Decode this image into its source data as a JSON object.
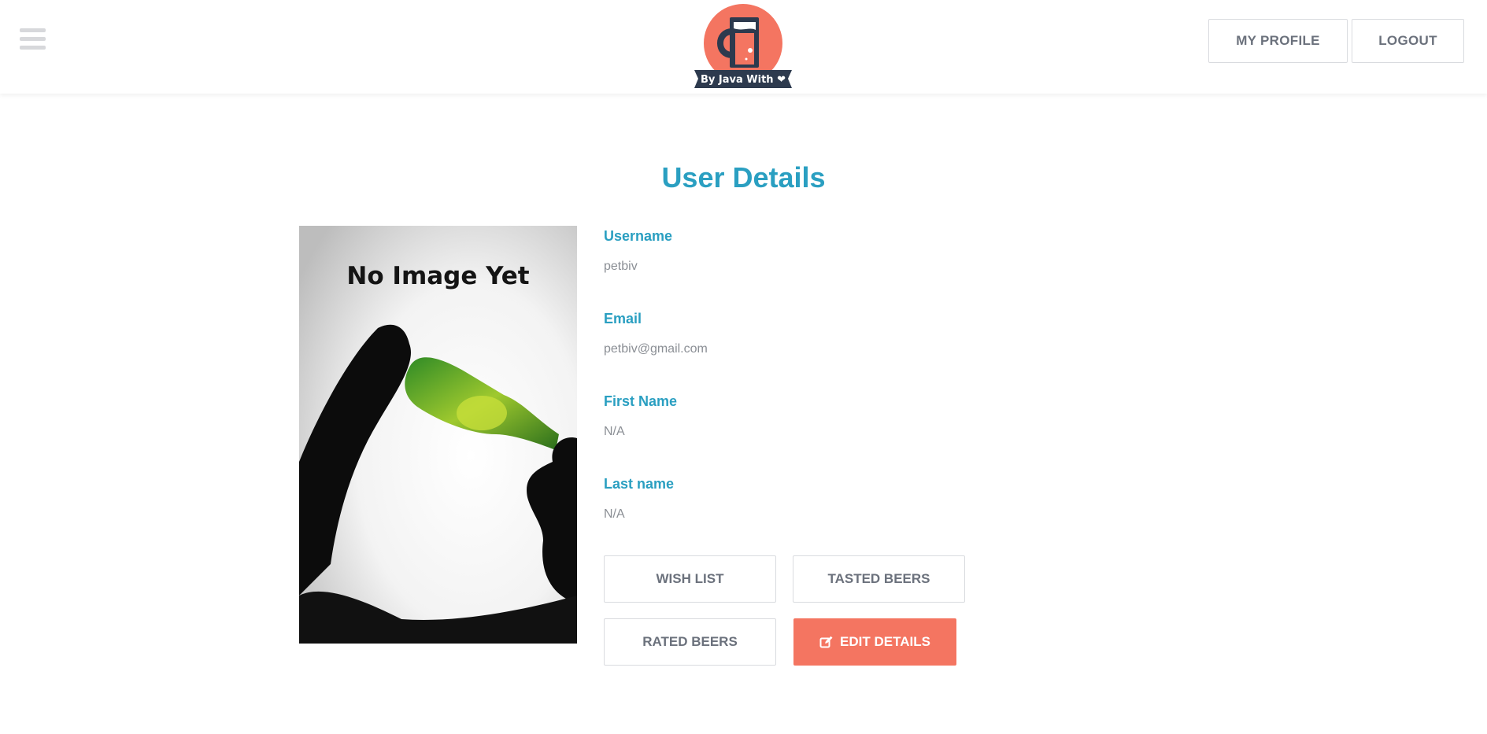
{
  "header": {
    "logo_text": "By Java With ❤",
    "nav": {
      "my_profile": "MY PROFILE",
      "logout": "LOGOUT"
    },
    "icons": [
      "hamburger-menu-icon",
      "beer-logo-icon"
    ]
  },
  "page": {
    "title": "User Details"
  },
  "profile_image": {
    "caption": "No Image Yet"
  },
  "details": {
    "username": {
      "label": "Username",
      "value": "petbiv"
    },
    "email": {
      "label": "Email",
      "value": "petbiv@gmail.com"
    },
    "first_name": {
      "label": "First Name",
      "value": "N/A"
    },
    "last_name": {
      "label": "Last name",
      "value": "N/A"
    }
  },
  "actions": {
    "wish_list": "WISH LIST",
    "tasted_beers": "TASTED BEERS",
    "rated_beers": "RATED BEERS",
    "edit_details": "EDIT DETAILS",
    "edit_icon": "edit-icon"
  },
  "colors": {
    "accent_blue": "#2a9fc1",
    "accent_coral": "#f47561",
    "navy": "#2d3a4e",
    "muted_text": "#8b8f95",
    "button_text": "#6b717c"
  }
}
